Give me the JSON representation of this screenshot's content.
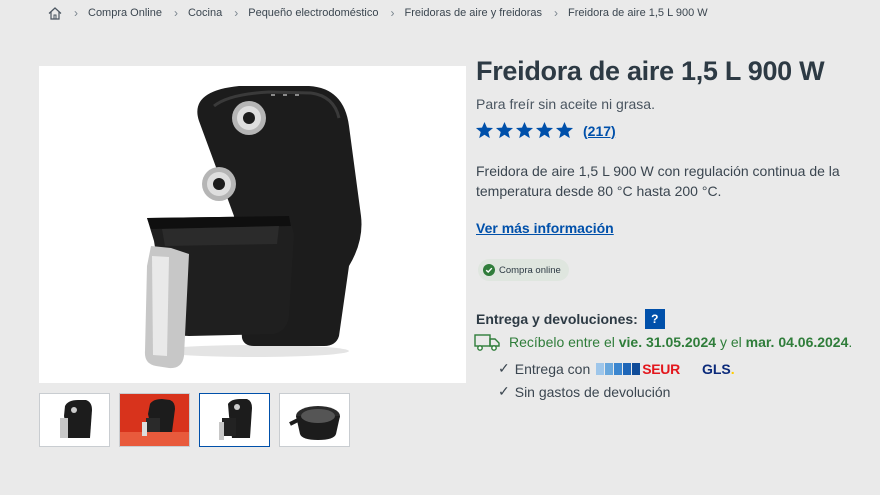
{
  "breadcrumb": {
    "home_icon": "home-icon",
    "items": [
      "Compra Online",
      "Cocina",
      "Pequeño electrodoméstico",
      "Freidoras de aire y freidoras",
      "Freidora de aire 1,5 L 900 W"
    ]
  },
  "product": {
    "title": "Freidora de aire 1,5 L 900 W",
    "subtitle": "Para freír sin aceite ni grasa.",
    "rating": {
      "stars": 5,
      "count_label": "(217)"
    },
    "description": "Freidora de aire 1,5 L 900 W con regulación continua de la temperatura desde 80 °C hasta 200 °C.",
    "more_info_label": "Ver más información",
    "availability_badge": "Compra online"
  },
  "delivery": {
    "heading": "Entrega y devoluciones:",
    "help_label": "?",
    "receive_prefix": "Recíbelo entre el",
    "date_from": "vie. 31.05.2024",
    "connector": "y el",
    "date_to": "mar. 04.06.2024",
    "date_suffix": ".",
    "carrier_label": "Entrega con",
    "carrier_1": "SEUR",
    "carrier_2": "GLS",
    "carrier_2_dot": ".",
    "return_label": "Sin gastos de devolución",
    "check_mark": "✓"
  },
  "gallery": {
    "thumbnail_count": 4,
    "active_index": 2
  },
  "colors": {
    "primary_blue": "#0050aa",
    "success_green": "#2f7d3a",
    "seur_red": "#e3171d",
    "gls_blue": "#0b2a7a",
    "gls_yellow": "#ffcc00",
    "star": "#0050aa"
  }
}
